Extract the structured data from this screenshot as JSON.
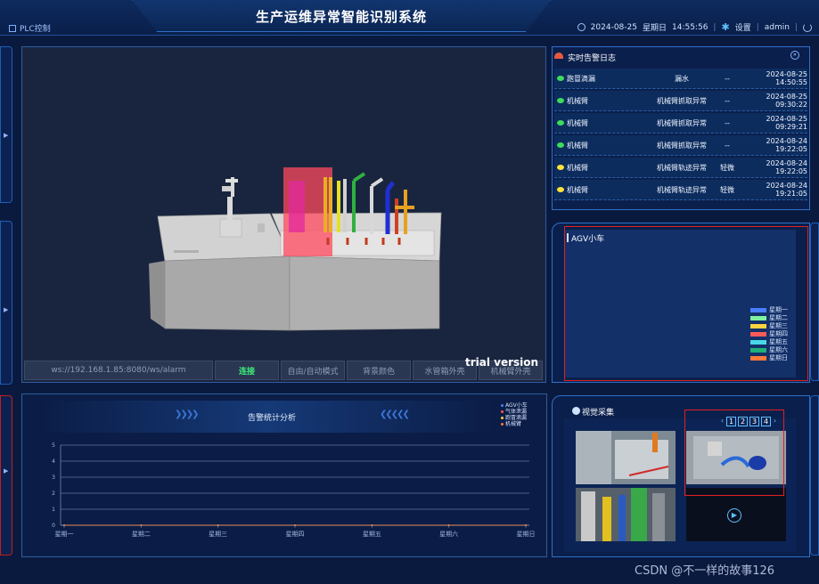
{
  "header": {
    "title": "生产运维异常智能识别系统",
    "plc_label": "PLC控制",
    "date": "2024-08-25",
    "weekday": "星期日",
    "time": "14:55:56",
    "settings_label": "设置",
    "user": "admin"
  },
  "viewer": {
    "ws_url": "ws://192.168.1.85:8080/ws/alarm",
    "buttons": [
      "连接",
      "自由/自动模式",
      "背景颜色",
      "水管箱外壳",
      "机械臂外壳"
    ],
    "trial_text": "trial version"
  },
  "alarm_chart": {
    "title": "告警统计分析",
    "legend": [
      {
        "name": "AGV小车",
        "color": "#4a7dff"
      },
      {
        "name": "气体泄漏",
        "color": "#ff5a5a"
      },
      {
        "name": "跑冒滴漏",
        "color": "#ffd23f"
      },
      {
        "name": "机械臂",
        "color": "#ff7a3a"
      }
    ]
  },
  "chart_data": {
    "type": "line",
    "title": "告警统计分析",
    "categories": [
      "星期一",
      "星期二",
      "星期三",
      "星期四",
      "星期五",
      "星期六",
      "星期日"
    ],
    "y_ticks": [
      "0",
      "1",
      "2",
      "3",
      "4",
      "5"
    ],
    "ylim": [
      0,
      5
    ],
    "series": [
      {
        "name": "AGV小车",
        "values": [
          0,
          0,
          0,
          0,
          0,
          0,
          0
        ]
      },
      {
        "name": "气体泄漏",
        "values": [
          0,
          0,
          0,
          0,
          0,
          0,
          0
        ]
      },
      {
        "name": "跑冒滴漏",
        "values": [
          0,
          0,
          0,
          0,
          0,
          0,
          0
        ]
      },
      {
        "name": "机械臂",
        "values": [
          0,
          0,
          0,
          0,
          0,
          0,
          0
        ]
      }
    ],
    "grid": true
  },
  "alarm_log": {
    "title": "实时告警日志",
    "rows": [
      {
        "source": "跑冒滴漏",
        "type": "漏水",
        "level": "--",
        "time": "2024-08-25 14:50:55",
        "status_color": "#3ddc5a"
      },
      {
        "source": "机械臂",
        "type": "机械臂抓取异常",
        "level": "--",
        "time": "2024-08-25 09:30:22",
        "status_color": "#3ddc5a"
      },
      {
        "source": "机械臂",
        "type": "机械臂抓取异常",
        "level": "--",
        "time": "2024-08-25 09:29:21",
        "status_color": "#3ddc5a"
      },
      {
        "source": "机械臂",
        "type": "机械臂抓取异常",
        "level": "--",
        "time": "2024-08-24 19:22:05",
        "status_color": "#3ddc5a"
      },
      {
        "source": "机械臂",
        "type": "机械臂轨迹异常",
        "level": "轻微",
        "time": "2024-08-24 19:22:05",
        "status_color": "#ffe23a"
      },
      {
        "source": "机械臂",
        "type": "机械臂轨迹异常",
        "level": "轻微",
        "time": "2024-08-24 19:21:05",
        "status_color": "#ffe23a"
      }
    ]
  },
  "agv": {
    "title": "AGV小车",
    "legend": [
      {
        "name": "星期一",
        "color": "#4a7dff"
      },
      {
        "name": "星期二",
        "color": "#7ff0a0"
      },
      {
        "name": "星期三",
        "color": "#ffd23f"
      },
      {
        "name": "星期四",
        "color": "#ff5a5a"
      },
      {
        "name": "星期五",
        "color": "#4ad6e8"
      },
      {
        "name": "星期六",
        "color": "#20b07a"
      },
      {
        "name": "星期日",
        "color": "#ff7a3a"
      }
    ]
  },
  "vision": {
    "title": "视觉采集",
    "pages": [
      "1",
      "2",
      "3",
      "4"
    ]
  },
  "watermark": "CSDN @不一样的故事126"
}
